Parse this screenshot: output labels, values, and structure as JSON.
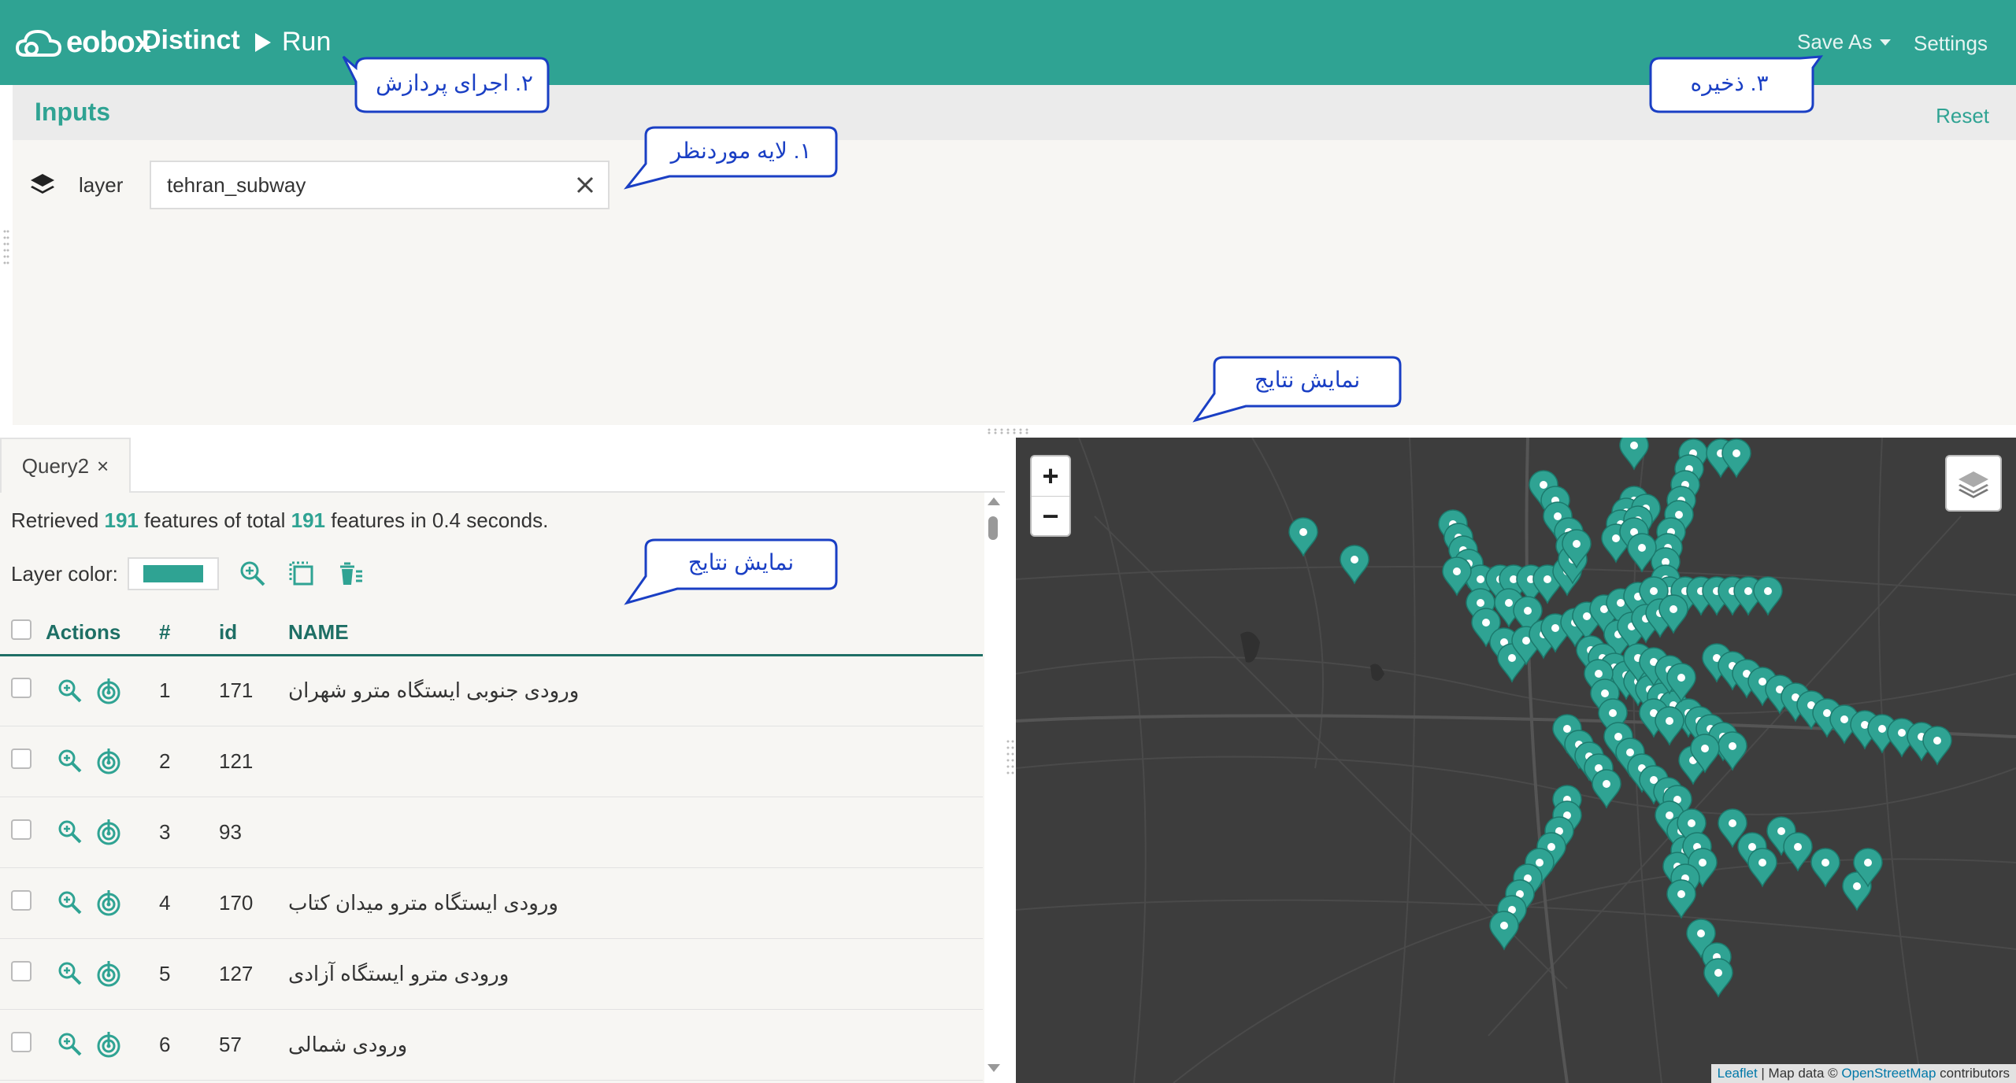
{
  "header": {
    "logo_text": "eobox",
    "app_title": "Distinct",
    "run_label": "Run",
    "save_as_label": "Save As",
    "settings_label": "Settings",
    "bar_color": "#2fa393"
  },
  "inputs": {
    "title": "Inputs",
    "reset_label": "Reset",
    "layer_label": "layer",
    "layer_value": "tehran_subway"
  },
  "results": {
    "tab_label": "Query2",
    "tab_close": "×",
    "summary": {
      "prefix": "Retrieved",
      "retrieved": "191",
      "middle": "features of total",
      "total": "191",
      "suffix": "features in 0.4 seconds."
    },
    "layer_color_label": "Layer color:",
    "layer_color": "#2fa393",
    "columns": [
      "Actions",
      "#",
      "id",
      "NAME"
    ],
    "rows": [
      {
        "num": "1",
        "id": "171",
        "name": "ورودی جنوبی ایستگاه مترو شهران"
      },
      {
        "num": "2",
        "id": "121",
        "name": ""
      },
      {
        "num": "3",
        "id": "93",
        "name": ""
      },
      {
        "num": "4",
        "id": "170",
        "name": "ورودی ایستگاه مترو میدان کتاب"
      },
      {
        "num": "5",
        "id": "127",
        "name": "ورودی مترو ایستگاه آزادی"
      },
      {
        "num": "6",
        "id": "57",
        "name": "ورودی شمالی"
      }
    ]
  },
  "map": {
    "zoom_in": "+",
    "zoom_out": "−",
    "attribution_leaflet": "Leaflet",
    "attribution_mid": "| Map data ©",
    "attribution_osm": "OpenStreetMap",
    "attribution_end": "contributors",
    "marker_color": "#2fa393",
    "background": "#3d3d3d"
  },
  "callouts": {
    "run": "۲. اجرای پردازش",
    "save": "۳. ذخیره",
    "layer": "۱. لایه موردنظر",
    "results_map": "نمایش نتایج",
    "results_table": "نمایش نتایج"
  }
}
